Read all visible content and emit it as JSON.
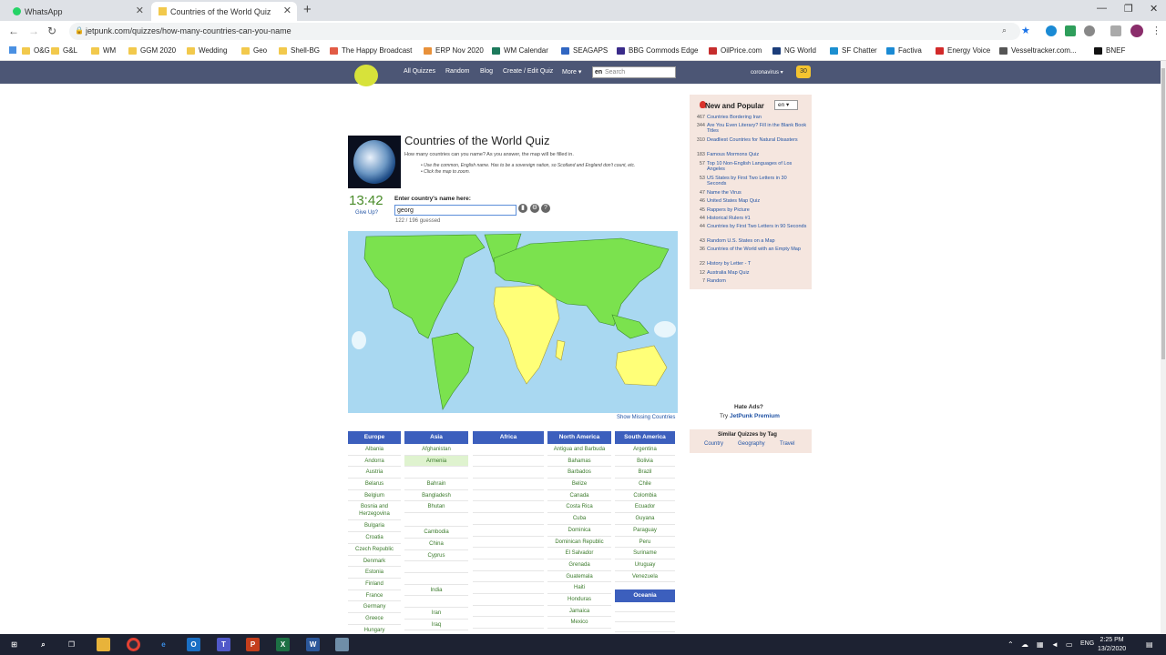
{
  "browser": {
    "tabs": [
      {
        "label": "WhatsApp"
      },
      {
        "label": "Countries of the World Quiz"
      }
    ],
    "url": "jetpunk.com/quizzes/how-many-countries-can-you-name",
    "bookmarks": [
      "O&G",
      "G&L",
      "WM",
      "GGM 2020",
      "Wedding",
      "Geo",
      "Shell-BG",
      "The Happy Broadcast",
      "ERP Nov 2020",
      "WM Calendar",
      "SEAGAPS",
      "BBG Commods Edge",
      "OilPrice.com",
      "NG World",
      "SF Chatter",
      "Factiva",
      "Energy Voice",
      "Vesseltracker.com...",
      "BNEF"
    ]
  },
  "site": {
    "nav": [
      "All Quizzes",
      "Random",
      "Blog",
      "Create / Edit Quiz",
      "More ▾"
    ],
    "search_lang": "en",
    "search_placeholder": "Search",
    "user": "coronavirus ▾",
    "badge": "30"
  },
  "quiz": {
    "title": "Countries of the World Quiz",
    "description": "How many countries can you name? As you answer, the map will be filled in.",
    "bullets": [
      "Use the common, English name. Has to be a sovereign nation, so Scotland and England don't count, etc.",
      "Click the map to zoom."
    ],
    "timer": "13:42",
    "give_up": "Give Up?",
    "prompt": "Enter country's name here:",
    "answer": "georg",
    "count": "122 / 196 guessed",
    "show_missing": "Show Missing Countries"
  },
  "columns": [
    {
      "header": "Europe",
      "cells": [
        "Albania",
        "Andorra",
        "Austria",
        "Belarus",
        "Belgium",
        "Bosnia and Herzegovina",
        "Bulgaria",
        "Croatia",
        "Czech Republic",
        "Denmark",
        "Estonia",
        "Finland",
        "France",
        "Germany",
        "Greece",
        "Hungary"
      ]
    },
    {
      "header": "Asia",
      "cells": [
        "Afghanistan",
        "Armenia",
        "",
        "Bahrain",
        "Bangladesh",
        "Bhutan",
        "",
        "Cambodia",
        "China",
        "Cyprus",
        "",
        "",
        "India",
        "",
        "Iran",
        "Iraq"
      ]
    },
    {
      "header": "Africa",
      "cells": [
        "",
        "",
        "",
        "",
        "",
        "",
        "",
        "",
        "",
        "",
        "",
        "",
        "",
        "",
        "",
        ""
      ]
    },
    {
      "header": "North America",
      "cells": [
        "Antigua and Barbuda",
        "Bahamas",
        "Barbados",
        "Belize",
        "Canada",
        "Costa Rica",
        "Cuba",
        "Dominica",
        "Dominican Republic",
        "El Salvador",
        "Grenada",
        "Guatemala",
        "Haiti",
        "Honduras",
        "Jamaica",
        "Mexico"
      ]
    },
    {
      "header": "South America",
      "cells": [
        "Argentina",
        "Bolivia",
        "Brazil",
        "Chile",
        "Colombia",
        "Ecuador",
        "Guyana",
        "Paraguay",
        "Peru",
        "Suriname",
        "Uruguay",
        "Venezuela"
      ]
    }
  ],
  "oceania": {
    "header": "Oceania"
  },
  "sidebar": {
    "title": "New and Popular",
    "lang": "en ▾",
    "items": [
      {
        "n": "467",
        "label": "Countries Bordering Iran"
      },
      {
        "n": "344",
        "label": "Are You Even Literary? Fill in the Blank Book Titles"
      },
      {
        "n": "310",
        "label": "Deadliest Countries for Natural Disasters"
      },
      {
        "n": "183",
        "label": "Famous Mormons Quiz"
      },
      {
        "n": "57",
        "label": "Top 10 Non-English Languages of Los Angeles"
      },
      {
        "n": "53",
        "label": "US States by First Two Letters in 30 Seconds"
      },
      {
        "n": "47",
        "label": "Name the Virus"
      },
      {
        "n": "46",
        "label": "United States Map Quiz"
      },
      {
        "n": "45",
        "label": "Rappers by Picture"
      },
      {
        "n": "44",
        "label": "Historical Rulers #1"
      },
      {
        "n": "44",
        "label": "Countries by First Two Letters in 90 Seconds"
      },
      {
        "n": "43",
        "label": "Random U.S. States on a Map"
      },
      {
        "n": "36",
        "label": "Countries of the World with an Empty Map"
      },
      {
        "n": "22",
        "label": "History by Letter - T"
      },
      {
        "n": "12",
        "label": "Australia Map Quiz"
      },
      {
        "n": "7",
        "label": "Random"
      }
    ],
    "hate_ads": "Hate Ads?",
    "try": "Try",
    "premium": "JetPunk Premium",
    "similar_title": "Similar Quizzes by Tag",
    "tags": [
      "Country",
      "Geography",
      "Travel"
    ]
  },
  "taskbar": {
    "time": "2:25 PM",
    "date": "13/2/2020",
    "lang": "ENG"
  }
}
